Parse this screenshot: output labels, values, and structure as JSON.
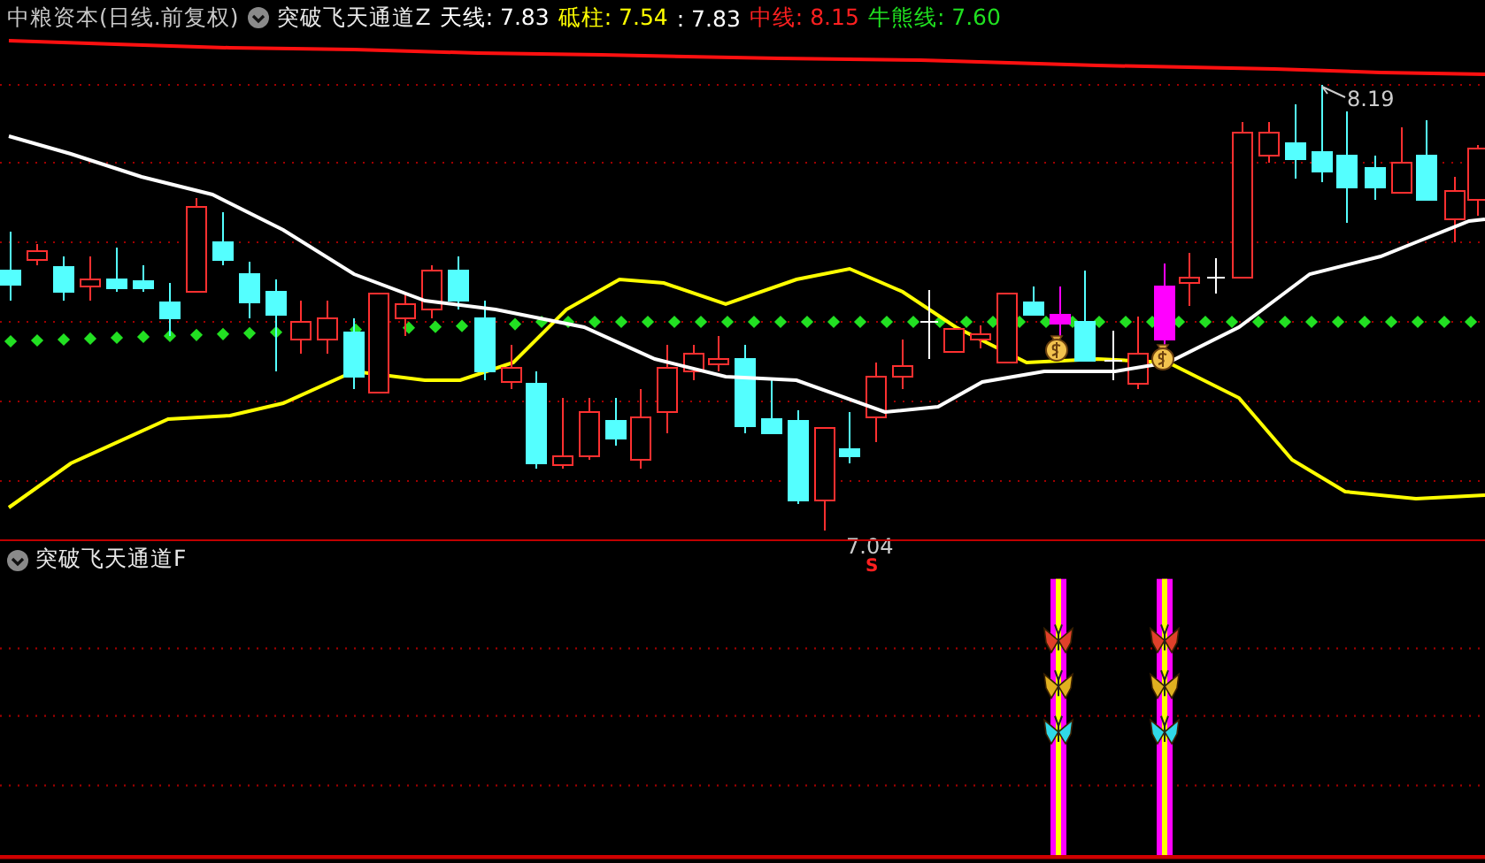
{
  "header": {
    "security": "中粮资本(日线.前复权)",
    "indicator": "突破飞天通道Z",
    "readings": [
      {
        "text": "天线: 7.83",
        "color": "#ffffff"
      },
      {
        "text": "砥柱: 7.54",
        "color": "#ffff00"
      },
      {
        "text": ": 7.83",
        "color": "#ffffff"
      },
      {
        "text": "中线: 8.15",
        "color": "#ff2020"
      },
      {
        "text": "牛熊线: 7.60",
        "color": "#20e020"
      }
    ]
  },
  "main_chart": {
    "high_label": "8.19",
    "low_label": "7.04",
    "signal_mark": "S"
  },
  "sub_panel": {
    "indicator": "突破飞天通道F"
  }
}
